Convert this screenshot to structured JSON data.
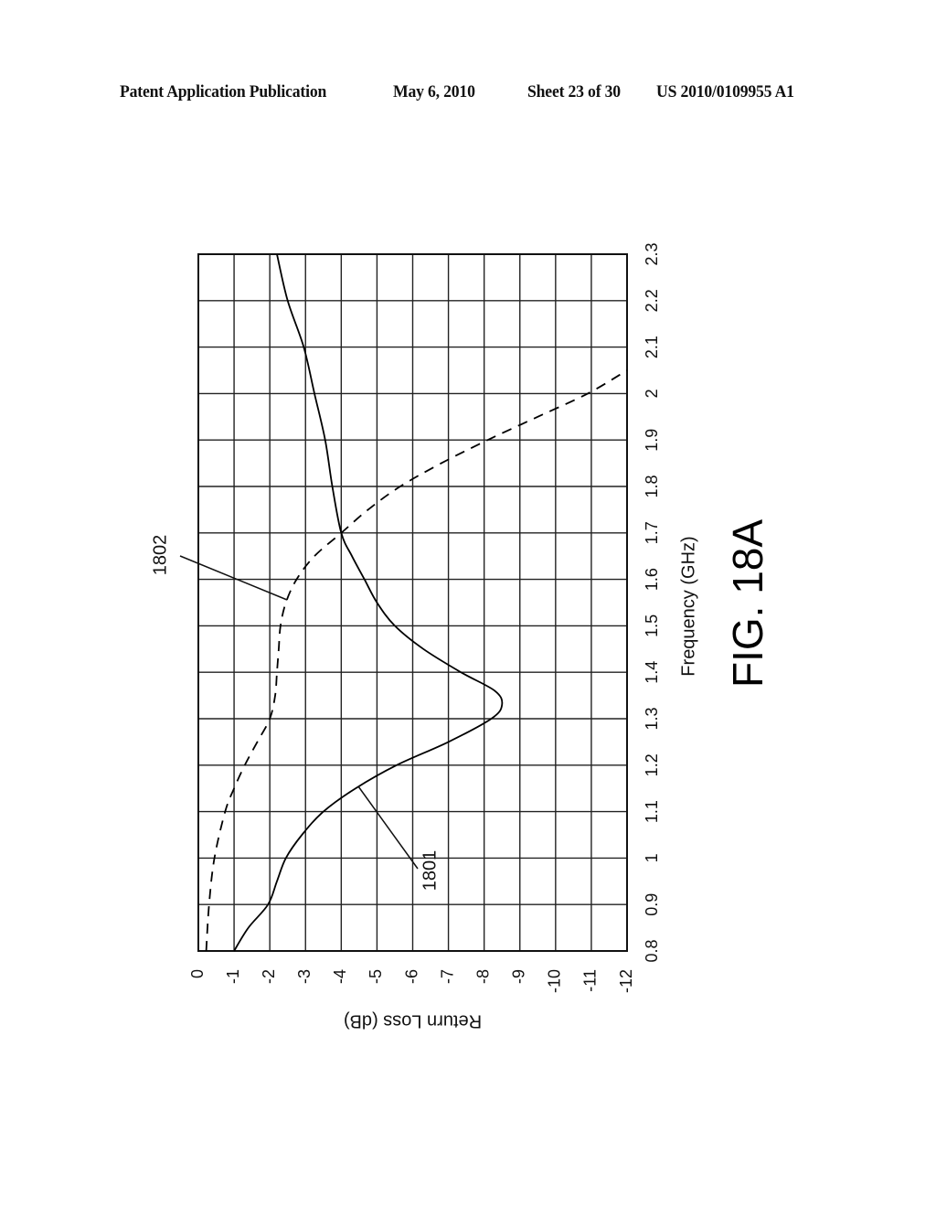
{
  "header": {
    "publication": "Patent Application Publication",
    "date": "May 6, 2010",
    "sheet": "Sheet 23 of 30",
    "number": "US 2010/0109955 A1"
  },
  "figure_label": "FIG. 18A",
  "chart_data": {
    "type": "line",
    "orientation": "rotated 90° counter-clockwise on the page",
    "title": "",
    "xlabel": "Frequency (GHz)",
    "ylabel": "Return Loss (dB)",
    "xlim": [
      0.8,
      2.3
    ],
    "ylim": [
      -12,
      0
    ],
    "x_ticks": [
      "0.8",
      "0.9",
      "1",
      "1.1",
      "1.2",
      "1.3",
      "1.4",
      "1.5",
      "1.6",
      "1.7",
      "1.8",
      "1.9",
      "2",
      "2.1",
      "2.2",
      "2.3"
    ],
    "y_ticks": [
      "0",
      "-1",
      "-2",
      "-3",
      "-4",
      "-5",
      "-6",
      "-7",
      "-8",
      "-9",
      "-10",
      "-11",
      "-12"
    ],
    "grid": true,
    "series": [
      {
        "name": "1801",
        "style": "solid",
        "x": [
          0.8,
          0.85,
          0.9,
          0.95,
          1.0,
          1.05,
          1.1,
          1.15,
          1.2,
          1.25,
          1.3,
          1.33,
          1.36,
          1.4,
          1.45,
          1.5,
          1.55,
          1.6,
          1.65,
          1.7,
          1.8,
          1.9,
          2.0,
          2.1,
          2.2,
          2.3
        ],
        "y": [
          -1.0,
          -1.4,
          -1.95,
          -2.2,
          -2.45,
          -2.9,
          -3.5,
          -4.4,
          -5.55,
          -7.0,
          -8.2,
          -8.5,
          -8.3,
          -7.35,
          -6.3,
          -5.5,
          -5.0,
          -4.65,
          -4.3,
          -4.0,
          -3.75,
          -3.55,
          -3.25,
          -2.95,
          -2.5,
          -2.2
        ]
      },
      {
        "name": "1802",
        "style": "dashed",
        "x": [
          0.8,
          0.9,
          1.0,
          1.1,
          1.15,
          1.2,
          1.25,
          1.3,
          1.35,
          1.4,
          1.45,
          1.5,
          1.55,
          1.6,
          1.65,
          1.7,
          1.75,
          1.8,
          1.85,
          1.9,
          1.95,
          2.0,
          2.05
        ],
        "y": [
          -0.22,
          -0.3,
          -0.45,
          -0.75,
          -1.0,
          -1.3,
          -1.65,
          -2.0,
          -2.15,
          -2.2,
          -2.25,
          -2.3,
          -2.45,
          -2.75,
          -3.25,
          -4.0,
          -4.75,
          -5.65,
          -6.8,
          -8.1,
          -9.5,
          -10.9,
          -12.0
        ]
      }
    ],
    "annotations": [
      {
        "text": "1801",
        "points_to": "solid curve near 1.15 GHz"
      },
      {
        "text": "1802",
        "points_to": "dashed curve near 1.55 GHz"
      }
    ]
  }
}
